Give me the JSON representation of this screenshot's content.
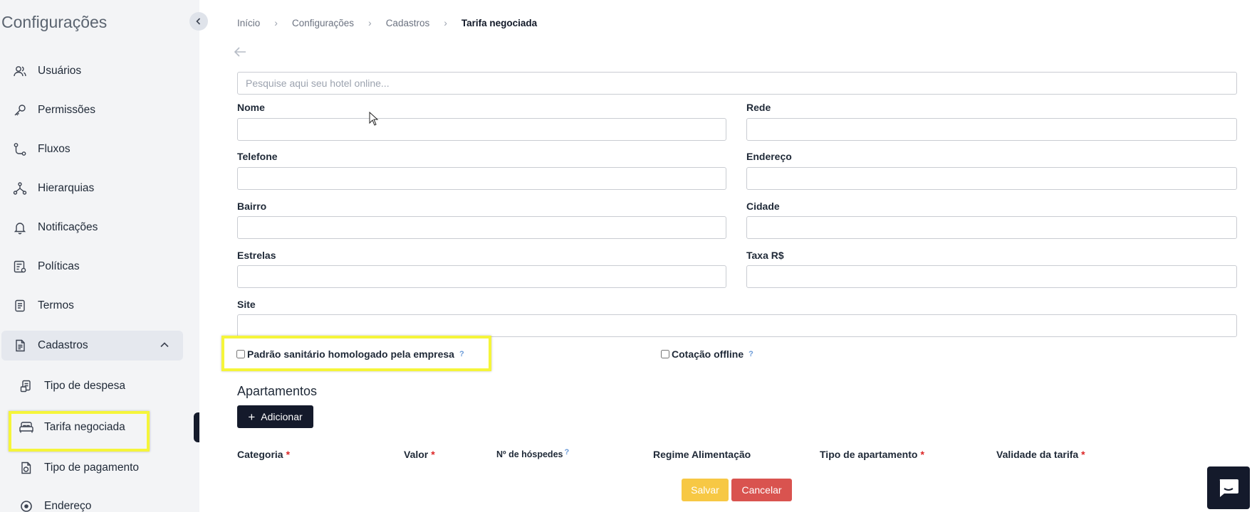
{
  "sidebar": {
    "title": "Configurações",
    "items": [
      {
        "label": "Usuários",
        "icon": "users-icon"
      },
      {
        "label": "Permissões",
        "icon": "key-icon"
      },
      {
        "label": "Fluxos",
        "icon": "flow-icon"
      },
      {
        "label": "Hierarquias",
        "icon": "hierarchy-icon"
      },
      {
        "label": "Notificações",
        "icon": "bell-icon"
      },
      {
        "label": "Políticas",
        "icon": "policy-icon"
      },
      {
        "label": "Termos",
        "icon": "document-icon"
      }
    ],
    "group": {
      "label": "Cadastros",
      "icon": "register-icon",
      "expanded": true,
      "children": [
        {
          "label": "Tipo de despesa",
          "icon": "expense-icon"
        },
        {
          "label": "Tarifa negociada",
          "icon": "bed-icon",
          "active": true
        },
        {
          "label": "Tipo de pagamento",
          "icon": "payment-icon"
        },
        {
          "label": "Endereço",
          "icon": "location-icon"
        }
      ]
    }
  },
  "breadcrumb": [
    "Início",
    "Configurações",
    "Cadastros",
    "Tarifa negociada"
  ],
  "search": {
    "placeholder": "Pesquise aqui seu hotel online..."
  },
  "form": {
    "nome": "Nome",
    "rede": "Rede",
    "telefone": "Telefone",
    "endereco": "Endereço",
    "bairro": "Bairro",
    "cidade": "Cidade",
    "estrelas": "Estrelas",
    "taxa": "Taxa R$",
    "site": "Site",
    "padrao_sanitario": "Padrão sanitário homologado pela empresa",
    "cotacao_offline": "Cotação offline"
  },
  "apartamentos": {
    "title": "Apartamentos",
    "add_label": "Adicionar",
    "columns": [
      {
        "label": "Categoria",
        "required": "*"
      },
      {
        "label": "Valor",
        "required": "*"
      },
      {
        "label": "Nº de hóspedes",
        "help": "?"
      },
      {
        "label": "Regime Alimentação"
      },
      {
        "label": "Tipo de apartamento",
        "required": "*"
      },
      {
        "label": "Validade da tarifa",
        "required": "*"
      }
    ]
  },
  "actions": {
    "save": "Salvar",
    "cancel": "Cancelar"
  },
  "colors": {
    "highlight": "#f5f53a",
    "primary": "#141a2b",
    "save": "#f7c844",
    "cancel": "#d9534f"
  }
}
